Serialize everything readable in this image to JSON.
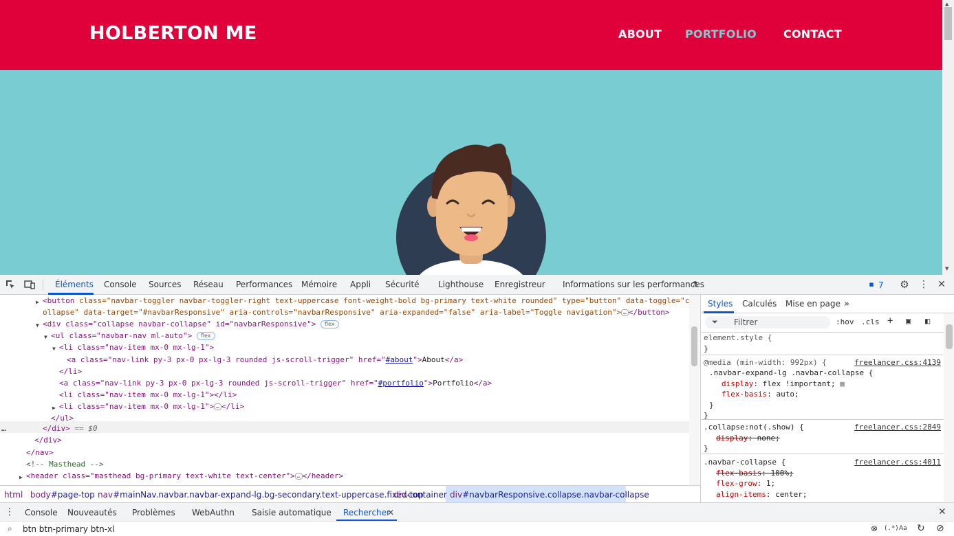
{
  "site": {
    "brand": "HOLBERTON ME",
    "nav": [
      "ABOUT",
      "PORTFOLIO",
      "CONTACT"
    ]
  },
  "devtools": {
    "tabs": [
      "Éléments",
      "Console",
      "Sources",
      "Réseau",
      "Performances",
      "Mémoire",
      "Appli",
      "Sécurité",
      "Lighthouse",
      "Enregistreur",
      "Informations sur les performances"
    ],
    "issues_count": "7",
    "tree": {
      "line1_tag_open": "<button ",
      "line1_attrs": "class=\"navbar-toggler navbar-toggler-right text-uppercase font-weight-bold bg-primary text-white rounded\" type=\"button\" data-toggle=\"c",
      "line2": "ollapse\" data-target=\"#navbarResponsive\" aria-controls=\"navbarResponsive\" aria-expanded=\"false\" aria-label=\"Toggle navigation\">",
      "line2_close": "</button>",
      "line3": "<div class=\"collapse navbar-collapse\" id=\"navbarResponsive\">",
      "line4": "<ul class=\"navbar-nav ml-auto\">",
      "pill_flex": "flex",
      "line5": "<li class=\"nav-item mx-0 mx-lg-1\">",
      "line6_pre": "<a class=\"nav-link py-3 px-0 px-lg-3 rounded js-scroll-trigger\" href=\"",
      "line6_href": "#about",
      "line6_post": "\">",
      "line6_text": "About",
      "line6_close": "</a>",
      "line7": "</li>",
      "line8_pre": "<a class=\"nav-link py-3 px-0 px-lg-3 rounded js-scroll-trigger\" href=\"",
      "line8_href": "#portfolio",
      "line8_post": "\">",
      "line8_text": "Portfolio",
      "line8_close": "</a>",
      "line9": "<li class=\"nav-item mx-0 mx-lg-1\"></li>",
      "line10": "<li class=\"nav-item mx-0 mx-lg-1\">",
      "line10_close": "</li>",
      "line11": "</ul>",
      "line12": "</div>",
      "line12_eq": " == $0",
      "line13": "</div>",
      "line14": "</nav>",
      "line15": "<!-- Masthead -->",
      "line16": "<header class=\"masthead bg-primary text-white text-center\">",
      "line16_close": "</header>",
      "dots": "…"
    },
    "breadcrumbs": [
      {
        "tag": "html",
        "cls": ""
      },
      {
        "tag": "body",
        "cls": "#page-top"
      },
      {
        "tag": "nav",
        "cls": "#mainNav.navbar.navbar-expand-lg.bg-secondary.text-uppercase.fixed-top"
      },
      {
        "tag": "div",
        "cls": ".container"
      },
      {
        "tag": "div",
        "cls": "#navbarResponsive.collapse.navbar-collapse"
      }
    ],
    "styles": {
      "tabs": [
        "Styles",
        "Calculés",
        "Mise en page"
      ],
      "filter_placeholder": "Filtrer",
      "hov": ":hov",
      "cls": ".cls",
      "element_style": "element.style {",
      "close_brace": "}",
      "media": "@media (min-width: 992px) {",
      "media_src": "freelancer.css:4139",
      "sel1": ".navbar-expand-lg .navbar-collapse {",
      "p1_name": "display",
      "p1_val": ": flex !important;",
      "p2_name": "flex-basis",
      "p2_val": ": auto;",
      "sel2": ".collapse:not(.show) {",
      "sel2_src": "freelancer.css:2849",
      "p3_name": "display",
      "p3_val": ": none;",
      "sel3": ".navbar-collapse {",
      "sel3_src": "freelancer.css:4011",
      "p4_name": "flex-basis",
      "p4_val": ": 100%;",
      "p5_name": "flex-grow",
      "p5_val": ": 1;",
      "p6_name": "align-items",
      "p6_val": ": center;"
    },
    "drawer": {
      "tabs": [
        "Console",
        "Nouveautés",
        "Problèmes",
        "WebAuthn",
        "Saisie automatique",
        "Rechercher"
      ],
      "search_value": "btn btn-primary btn-xl",
      "regex": "(.*)",
      "case": "Aa"
    }
  }
}
